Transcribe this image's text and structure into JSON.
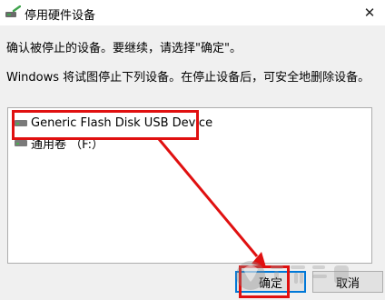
{
  "window": {
    "title": "停用硬件设备",
    "close_symbol": "✕"
  },
  "message": {
    "confirm": "确认被停止的设备。要继续，请选择\"确定\"。",
    "info": "Windows 将试图停止下列设备。在停止设备后，可安全地删除设备。"
  },
  "devices": [
    {
      "label": "Generic Flash Disk USB Device"
    },
    {
      "label": "通用卷  （F:）"
    }
  ],
  "buttons": {
    "stop_label": "确定",
    "cancel_label": "取消"
  },
  "colors": {
    "highlight": "#e01010",
    "focus": "#0078d7"
  },
  "icons": {
    "title": "safely-remove-hardware-icon",
    "device": "drive-icon",
    "close": "close-icon"
  }
}
